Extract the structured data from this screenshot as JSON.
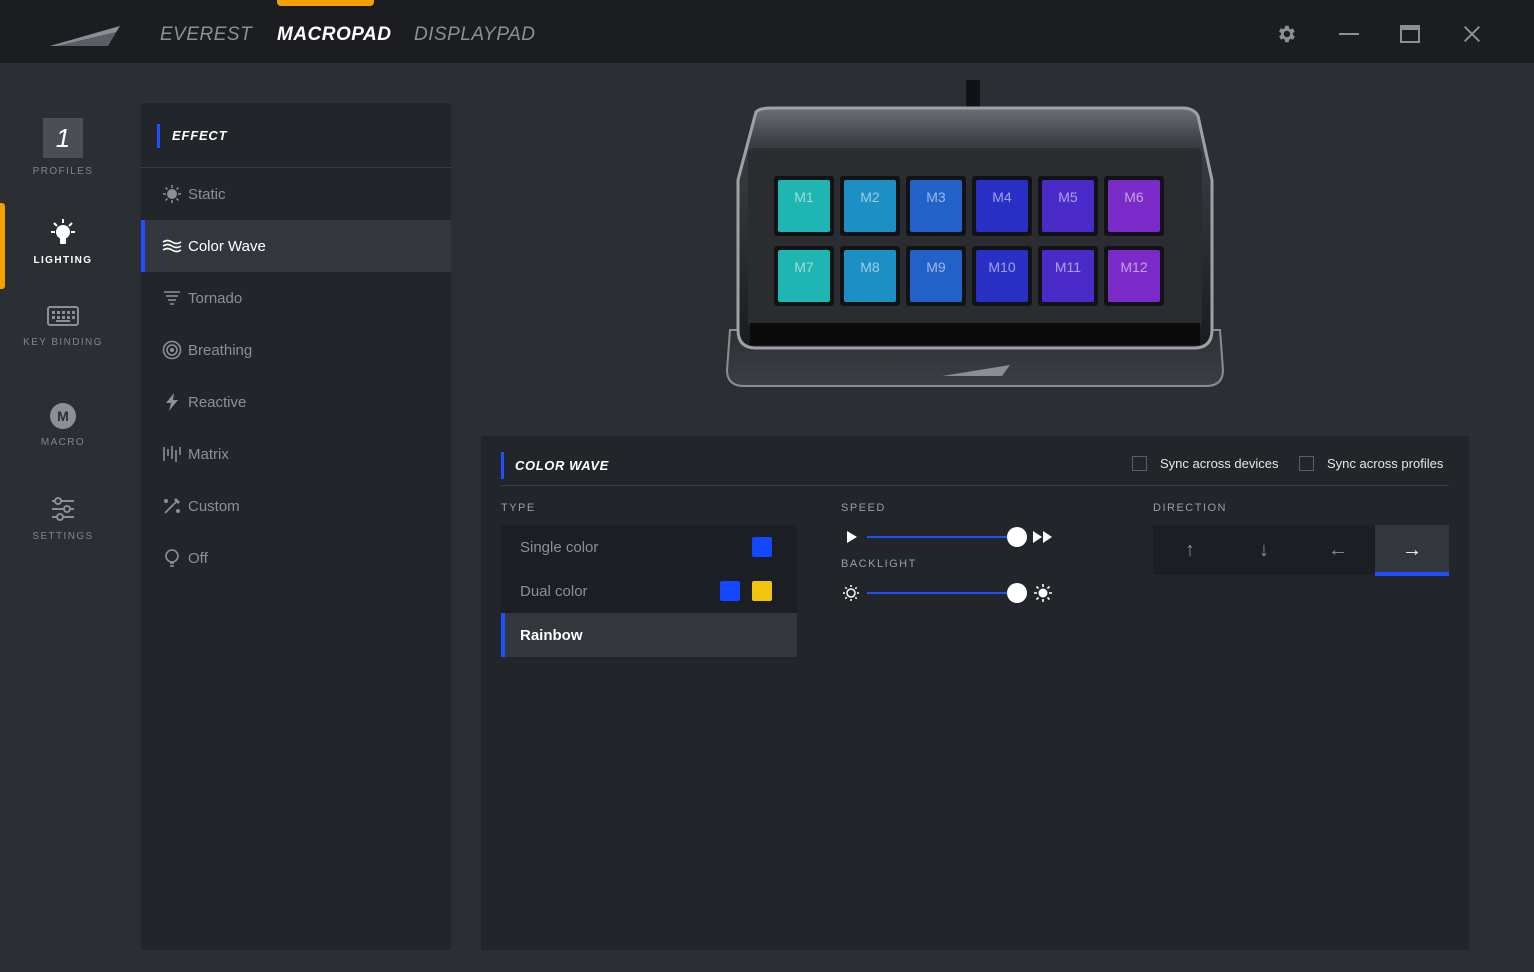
{
  "device_tabs": [
    {
      "label": "EVEREST",
      "active": false
    },
    {
      "label": "MACROPAD",
      "active": true
    },
    {
      "label": "DISPLAYPAD",
      "active": false
    }
  ],
  "window_controls": [
    "gear-icon",
    "minimize-icon",
    "maximize-icon",
    "close-icon"
  ],
  "nav": {
    "profile_number": "1",
    "items": [
      {
        "label": "PROFILES",
        "icon": "profile-number",
        "active": false
      },
      {
        "label": "LIGHTING",
        "icon": "bulb-icon",
        "active": true
      },
      {
        "label": "KEY BINDING",
        "icon": "keyboard-icon",
        "active": false
      },
      {
        "label": "MACRO",
        "icon": "macro-icon",
        "active": false
      },
      {
        "label": "SETTINGS",
        "icon": "sliders-icon",
        "active": false
      }
    ],
    "macro_icon_letter": "M"
  },
  "effect": {
    "title": "EFFECT",
    "items": [
      {
        "label": "Static",
        "icon": "sun-bulb-icon",
        "active": false
      },
      {
        "label": "Color Wave",
        "icon": "wave-icon",
        "active": true
      },
      {
        "label": "Tornado",
        "icon": "tornado-icon",
        "active": false
      },
      {
        "label": "Breathing",
        "icon": "breathing-icon",
        "active": false
      },
      {
        "label": "Reactive",
        "icon": "bolt-icon",
        "active": false
      },
      {
        "label": "Matrix",
        "icon": "matrix-icon",
        "active": false
      },
      {
        "label": "Custom",
        "icon": "custom-icon",
        "active": false
      },
      {
        "label": "Off",
        "icon": "bulb-off-icon",
        "active": false
      }
    ]
  },
  "macropad": {
    "keys": [
      {
        "label": "M1",
        "color": "#1fb5b2"
      },
      {
        "label": "M2",
        "color": "#1d8fc4"
      },
      {
        "label": "M3",
        "color": "#2261c8"
      },
      {
        "label": "M4",
        "color": "#2a2fc6"
      },
      {
        "label": "M5",
        "color": "#4a2ac9"
      },
      {
        "label": "M6",
        "color": "#7a2ac6"
      },
      {
        "label": "M7",
        "color": "#1fb5b2"
      },
      {
        "label": "M8",
        "color": "#1d8fc4"
      },
      {
        "label": "M9",
        "color": "#2261c8"
      },
      {
        "label": "M10",
        "color": "#2a2fc6"
      },
      {
        "label": "M11",
        "color": "#4a2ac9"
      },
      {
        "label": "M12",
        "color": "#7a2ac6"
      }
    ]
  },
  "settings": {
    "title": "COLOR WAVE",
    "sync_devices": {
      "label": "Sync across devices",
      "checked": false
    },
    "sync_profiles": {
      "label": "Sync across profiles",
      "checked": false
    },
    "type_label": "TYPE",
    "types": [
      {
        "label": "Single color",
        "colors": [
          "#1448ff"
        ],
        "active": false
      },
      {
        "label": "Dual color",
        "colors": [
          "#1448ff",
          "#f1c40f"
        ],
        "active": false
      },
      {
        "label": "Rainbow",
        "colors": [],
        "active": true
      }
    ],
    "speed_label": "SPEED",
    "speed_value": 1.0,
    "backlight_label": "BACKLIGHT",
    "backlight_value": 1.0,
    "direction_label": "DIRECTION",
    "directions": [
      {
        "glyph": "↑",
        "name": "arrow-up",
        "active": false
      },
      {
        "glyph": "↓",
        "name": "arrow-down",
        "active": false
      },
      {
        "glyph": "←",
        "name": "arrow-left",
        "active": false
      },
      {
        "glyph": "→",
        "name": "arrow-right",
        "active": true
      }
    ]
  },
  "colors": {
    "accent_blue": "#1f4fff",
    "accent_orange": "#f5a000",
    "background": "#2b2f34",
    "panel": "#22262a",
    "topbar": "#1b1d20"
  }
}
